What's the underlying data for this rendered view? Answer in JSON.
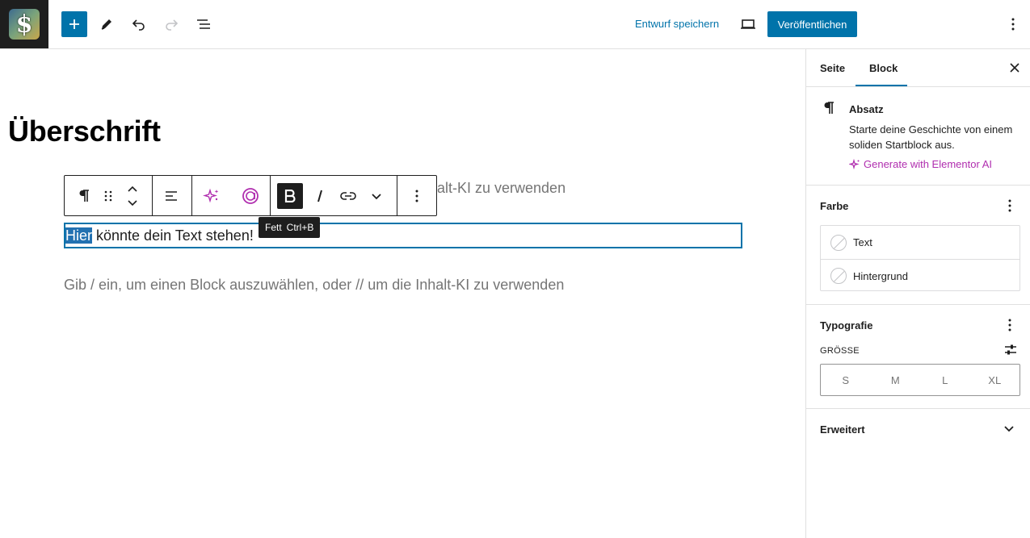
{
  "topbar": {
    "site_logo_glyph": "$",
    "save_draft_label": "Entwurf speichern",
    "publish_label": "Veröffentlichen"
  },
  "editor": {
    "heading": "Überschrift",
    "placeholder_partial": "alt-KI zu verwenden",
    "placeholder_full": "Gib / ein, um einen Block auszuwählen, oder // um die Inhalt-KI zu verwenden",
    "paragraph_selected": "Hier",
    "paragraph_rest": " könnte dein Text stehen!",
    "tooltip_label": "Fett",
    "tooltip_shortcut": "Ctrl+B"
  },
  "sidebar": {
    "tabs": [
      {
        "label": "Seite"
      },
      {
        "label": "Block",
        "active": true
      }
    ],
    "block_card": {
      "title": "Absatz",
      "description": "Starte deine Geschichte von einem soliden Startblock aus.",
      "ai_link": "Generate with Elementor AI"
    },
    "color_panel": {
      "title": "Farbe",
      "items": [
        {
          "label": "Text"
        },
        {
          "label": "Hintergrund"
        }
      ]
    },
    "typography_panel": {
      "title": "Typografie",
      "size_label": "GRÖSSE",
      "sizes": [
        "S",
        "M",
        "L",
        "XL"
      ]
    },
    "advanced_panel": {
      "title": "Erweitert"
    }
  },
  "colors": {
    "accent": "#0073aa",
    "ai_purple": "#b02eaf",
    "dark": "#1e1e1e",
    "selection": "#2271b1"
  }
}
